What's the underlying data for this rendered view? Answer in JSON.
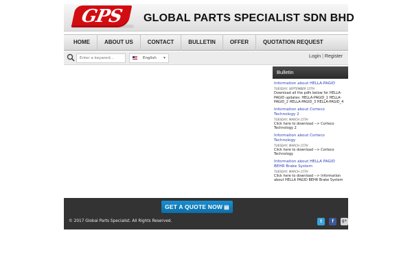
{
  "header": {
    "logo_text": "GPS",
    "company_name": "GLOBAL PARTS SPECIALIST SDN BHD"
  },
  "nav": {
    "items": [
      {
        "label": "HOME"
      },
      {
        "label": "ABOUT US"
      },
      {
        "label": "CONTACT"
      },
      {
        "label": "BULLETIN"
      },
      {
        "label": "OFFER"
      },
      {
        "label": "QUOTATION REQUEST"
      }
    ]
  },
  "search": {
    "placeholder": "Enter a keyword...",
    "language": "English"
  },
  "auth": {
    "login": "Login",
    "separator": "|",
    "register": "Register"
  },
  "sidebar": {
    "title": "Bulletin",
    "posts": [
      {
        "title": "Information about HELLA-PAGID",
        "date": "Tuesday, September 15th",
        "body": "Download all the pdfs below for HELLA-PAGID updates:    HELLA-PAGID_1    HELLA-PAGID_2    HELLA-PAGID_3    HELLA-PAGID_4"
      },
      {
        "title": "Information about Corteco Technology 2",
        "date": "Tuesday, March 15th",
        "body": "Click here to download --> Corteco Technology 2"
      },
      {
        "title": "Information about Corteco Technology",
        "date": "Tuesday, March 15th",
        "body": "Click here to download --> Corteco Technology"
      },
      {
        "title": "Information about HELLA PAGID BEHR Brake System",
        "date": "Tuesday, March 15th",
        "body": "Click here to download --> Information about HELLA PAGID BEHR Brake System"
      }
    ]
  },
  "footer": {
    "quote_button": "GET A QUOTE NOW",
    "copyright": "© 2017 Global Parts Specialist. All Rights Reserved.",
    "social": {
      "twitter": "t",
      "facebook": "f",
      "gplus": "g+"
    }
  },
  "colors": {
    "accent_red": "#d20d12",
    "quote_blue": "#0c6da8",
    "link_blue": "#2a3fb5",
    "footer_bg": "#333333"
  },
  "icons": [
    "search-icon",
    "flag-icon",
    "chevron-down-icon",
    "doc-icon",
    "twitter-icon",
    "facebook-icon",
    "gplus-icon"
  ]
}
